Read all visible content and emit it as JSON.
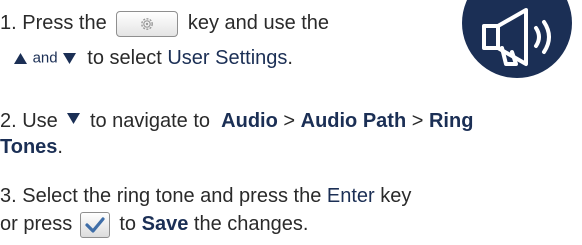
{
  "step1": {
    "line1_prefix": "1. Press the",
    "line1_suffix": "key and use the",
    "and_text": "and",
    "line2_mid": "to select",
    "user_settings": "User Settings",
    "period": "."
  },
  "step2": {
    "prefix": "2. Use",
    "mid": "to navigate to",
    "audio": "Audio",
    "sep1": ">",
    "audio_path": "Audio Path",
    "sep2": ">",
    "ring": "Ring",
    "tones": "Tones",
    "period": "."
  },
  "step3": {
    "line1_prefix": "3. Select the ring tone and press the",
    "enter": "Enter",
    "line1_suffix": "key",
    "line2_prefix": "or press",
    "to": "to",
    "save": "Save",
    "line2_suffix": "the changes."
  },
  "icons": {
    "settings_key": "gear-icon",
    "up_arrow": "triangle-up-icon",
    "down_arrow": "triangle-down-icon",
    "save_key": "checkmark-icon",
    "badge": "megaphone-icon"
  },
  "colors": {
    "text": "#2a2a2a",
    "accent": "#1b2f55",
    "badge": "#1b2f55"
  }
}
